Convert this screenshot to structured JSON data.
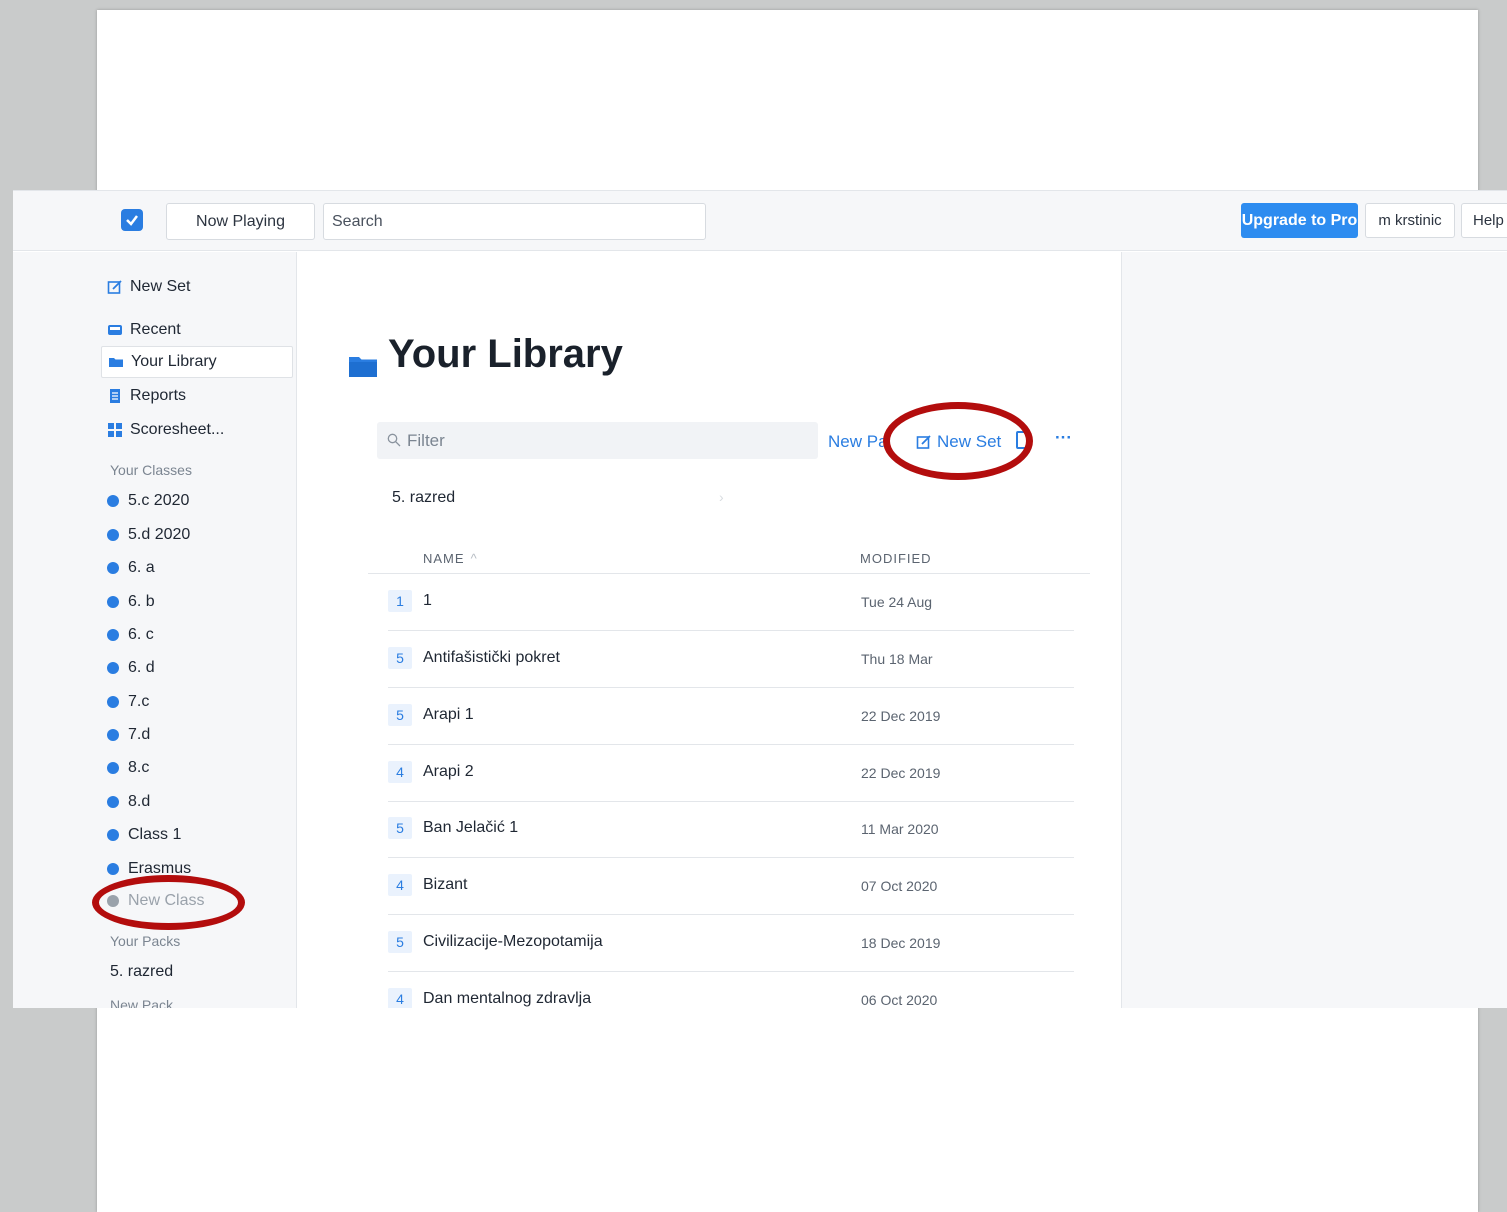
{
  "topbar": {
    "now_playing": "Now Playing",
    "search_placeholder": "Search",
    "upgrade": "Upgrade to Pro",
    "user": "m krstinic",
    "help": "Help"
  },
  "sidebar": {
    "new_set": "New Set",
    "recent": "Recent",
    "library": "Your Library",
    "reports": "Reports",
    "scoresheet": "Scoresheet...",
    "classes_header": "Your Classes",
    "classes": [
      "5.c 2020",
      "5.d 2020",
      "6. a",
      "6. b",
      "6. c",
      "6. d",
      "7.c",
      "7.d",
      "8.c",
      "8.d",
      "Class 1",
      "Erasmus"
    ],
    "new_class": "New Class",
    "packs_header": "Your Packs",
    "packs": [
      "5. razred"
    ],
    "new_pack": "New Pack"
  },
  "main": {
    "title": "Your Library",
    "filter_placeholder": "Filter",
    "new_pack_action": "New Pa",
    "new_set_action": "New Set",
    "more": "···",
    "pack_row": "5. razred",
    "col_name": "NAME",
    "col_modified": "MODIFIED",
    "rows": [
      {
        "count": "1",
        "name": "1",
        "modified": "Tue 24 Aug"
      },
      {
        "count": "5",
        "name": "Antifašistički pokret",
        "modified": "Thu 18 Mar"
      },
      {
        "count": "5",
        "name": "Arapi 1",
        "modified": "22 Dec 2019"
      },
      {
        "count": "4",
        "name": "Arapi 2",
        "modified": "22 Dec 2019"
      },
      {
        "count": "5",
        "name": "Ban Jelačić 1",
        "modified": "11 Mar 2020"
      },
      {
        "count": "4",
        "name": "Bizant",
        "modified": "07 Oct 2020"
      },
      {
        "count": "5",
        "name": "Civilizacije-Mezopotamija",
        "modified": "18 Dec 2019"
      },
      {
        "count": "4",
        "name": "Dan mentalnog zdravlja",
        "modified": "06 Oct 2020"
      }
    ]
  },
  "colors": {
    "accent": "#2a7de1",
    "annotation": "#b30d0d"
  }
}
